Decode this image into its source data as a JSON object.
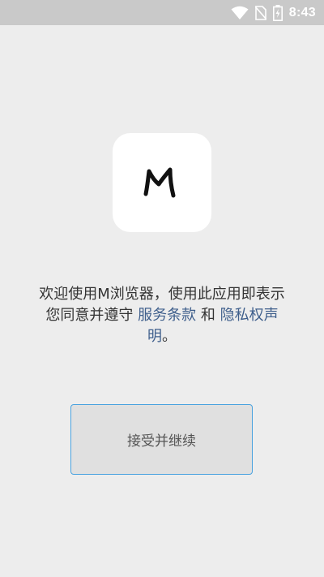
{
  "status_bar": {
    "time": "8:43",
    "icons": [
      "wifi-icon",
      "no-sim-icon",
      "battery-charging-icon"
    ],
    "color": "#ffffff"
  },
  "app": {
    "logo_letter": "M"
  },
  "consent": {
    "text_before": "欢迎使用M浏览器，使用此应用即表示您同意并遵守",
    "terms_link": "服务条款",
    "conjunction": "和",
    "privacy_link": "隐私权声明",
    "text_end": "。"
  },
  "accept_button": {
    "label": "接受并继续"
  },
  "colors": {
    "background": "#ededed",
    "status_bar": "#c9c9c9",
    "link": "#3f5f8c",
    "button_border": "#4aa3e0",
    "button_fill": "#e0e0e0"
  }
}
